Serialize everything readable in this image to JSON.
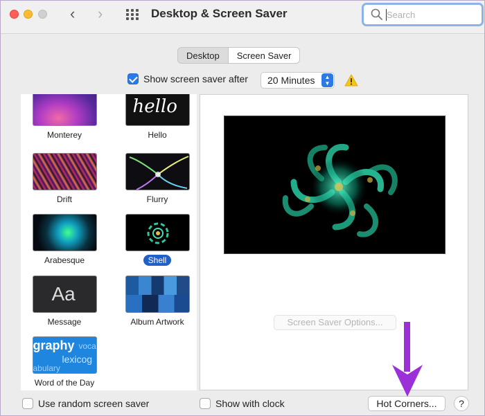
{
  "window": {
    "title": "Desktop & Screen Saver"
  },
  "search": {
    "placeholder": "Search",
    "value": ""
  },
  "tabs": [
    {
      "label": "Desktop",
      "active": false
    },
    {
      "label": "Screen Saver",
      "active": true
    }
  ],
  "show_after": {
    "label": "Show screen saver after",
    "checked": true,
    "value": "20 Minutes"
  },
  "savers": [
    {
      "label": "Monterey"
    },
    {
      "label": "Hello",
      "thumb_text": "hello"
    },
    {
      "label": "Drift"
    },
    {
      "label": "Flurry"
    },
    {
      "label": "Arabesque"
    },
    {
      "label": "Shell",
      "selected": true
    },
    {
      "label": "Message",
      "thumb_text": "Aa"
    },
    {
      "label": "Album Artwork"
    },
    {
      "label": "Word of the Day",
      "thumb_words": [
        "graphy",
        "voca",
        "lexicog",
        "abulary"
      ]
    }
  ],
  "options_button": "Screen Saver Options...",
  "random_saver": {
    "label": "Use random screen saver",
    "checked": false
  },
  "show_clock": {
    "label": "Show with clock",
    "checked": false
  },
  "hot_corners_button": "Hot Corners...",
  "help_button": "?",
  "colors": {
    "accent": "#2c7be5",
    "selection": "#2260c9",
    "annotation_arrow": "#9b30d9"
  }
}
